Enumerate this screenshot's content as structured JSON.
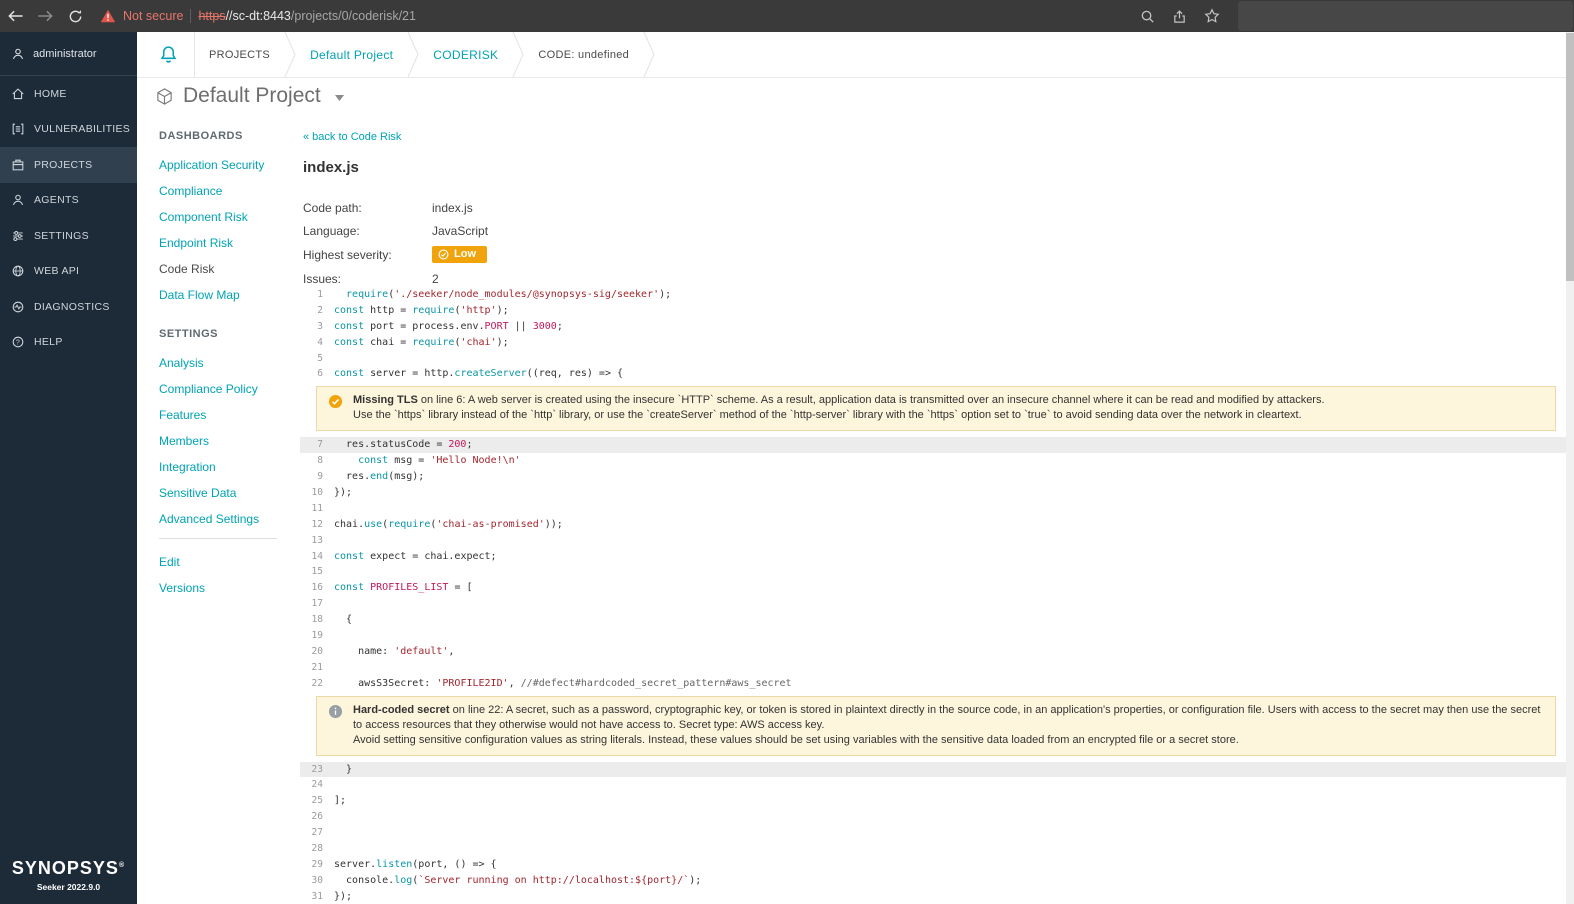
{
  "browser": {
    "security_label": "Not secure",
    "url_scheme": "https",
    "url_host": "//sc-dt:8443",
    "url_path": "/projects/0/coderisk/21"
  },
  "colors": {
    "accent_teal": "#00a3b4",
    "severity_low": "#f0a30a",
    "issue_background": "#fdf5dc",
    "sidebar_background": "#1d2a38",
    "not_secure_red": "#e0544a"
  },
  "sidebar": {
    "user": "administrator",
    "items": [
      {
        "label": "HOME",
        "icon": "home-icon",
        "active": false
      },
      {
        "label": "VULNERABILITIES",
        "icon": "vulnerabilities-icon",
        "active": false
      },
      {
        "label": "PROJECTS",
        "icon": "projects-icon",
        "active": true
      },
      {
        "label": "AGENTS",
        "icon": "agents-icon",
        "active": false
      },
      {
        "label": "SETTINGS",
        "icon": "settings-icon",
        "active": false
      },
      {
        "label": "WEB API",
        "icon": "webapi-icon",
        "active": false
      },
      {
        "label": "DIAGNOSTICS",
        "icon": "diagnostics-icon",
        "active": false
      },
      {
        "label": "HELP",
        "icon": "help-icon",
        "active": false
      }
    ],
    "logo": "SYNOPSYS",
    "logo_reg": "®",
    "version": "Seeker 2022.9.0"
  },
  "breadcrumb": {
    "items": [
      {
        "label": "PROJECTS",
        "style": "plain"
      },
      {
        "label": "Default Project",
        "style": "link"
      },
      {
        "label": "CODERISK",
        "style": "link"
      },
      {
        "label": "CODE: undefined",
        "style": "plain"
      }
    ]
  },
  "page": {
    "title": "Default Project"
  },
  "subnav": {
    "sections": [
      {
        "heading": "DASHBOARDS",
        "items": [
          {
            "label": "Application Security",
            "active": false
          },
          {
            "label": "Compliance",
            "active": false
          },
          {
            "label": "Component Risk",
            "active": false
          },
          {
            "label": "Endpoint Risk",
            "active": false
          },
          {
            "label": "Code Risk",
            "active": true
          },
          {
            "label": "Data Flow Map",
            "active": false
          }
        ]
      },
      {
        "heading": "SETTINGS",
        "items": [
          {
            "label": "Analysis",
            "active": false
          },
          {
            "label": "Compliance Policy",
            "active": false
          },
          {
            "label": "Features",
            "active": false
          },
          {
            "label": "Members",
            "active": false
          },
          {
            "label": "Integration",
            "active": false
          },
          {
            "label": "Sensitive Data",
            "active": false
          },
          {
            "label": "Advanced Settings",
            "active": false
          }
        ]
      }
    ],
    "footer_items": [
      {
        "label": "Edit"
      },
      {
        "label": "Versions"
      }
    ]
  },
  "content": {
    "back_link": "« back to Code Risk",
    "file_title": "index.js",
    "details": [
      {
        "label": "Code path:",
        "value": "index.js",
        "type": "text"
      },
      {
        "label": "Language:",
        "value": "JavaScript",
        "type": "text"
      },
      {
        "label": "Highest severity:",
        "value": "Low",
        "type": "badge"
      },
      {
        "label": "Issues:",
        "value": "2",
        "type": "text"
      }
    ]
  },
  "code": {
    "highlight_lines": [
      7,
      23
    ],
    "lines": [
      {
        "n": 1,
        "t": [
          [
            "kw",
            "  require"
          ],
          [
            "p",
            "("
          ],
          [
            "str",
            "'./seeker/node_modules/@synopsys-sig/seeker'"
          ],
          [
            "p",
            ");"
          ]
        ]
      },
      {
        "n": 2,
        "t": [
          [
            "kw",
            "const"
          ],
          [
            "p",
            " http = "
          ],
          [
            "kw",
            "require"
          ],
          [
            "p",
            "("
          ],
          [
            "str",
            "'http'"
          ],
          [
            "p",
            ");"
          ]
        ]
      },
      {
        "n": 3,
        "t": [
          [
            "kw",
            "const"
          ],
          [
            "p",
            " port = process.env."
          ],
          [
            "cn",
            "PORT"
          ],
          [
            "p",
            " || "
          ],
          [
            "num",
            "3000"
          ],
          [
            "p",
            ";"
          ]
        ]
      },
      {
        "n": 4,
        "t": [
          [
            "kw",
            "const"
          ],
          [
            "p",
            " chai = "
          ],
          [
            "kw",
            "require"
          ],
          [
            "p",
            "("
          ],
          [
            "str",
            "'chai'"
          ],
          [
            "p",
            ");"
          ]
        ]
      },
      {
        "n": 5,
        "t": []
      },
      {
        "n": 6,
        "t": [
          [
            "kw",
            "const"
          ],
          [
            "p",
            " server = http."
          ],
          [
            "fn",
            "createServer"
          ],
          [
            "p",
            "((req, res) => {"
          ]
        ]
      },
      {
        "n": 7,
        "t": [
          [
            "p",
            "  res.statusCode = "
          ],
          [
            "num",
            "200"
          ],
          [
            "p",
            ";"
          ]
        ]
      },
      {
        "n": 8,
        "t": [
          [
            "p",
            "    "
          ],
          [
            "kw",
            "const"
          ],
          [
            "p",
            " msg = "
          ],
          [
            "str",
            "'Hello Node!\\n'"
          ]
        ]
      },
      {
        "n": 9,
        "t": [
          [
            "p",
            "  res."
          ],
          [
            "fn",
            "end"
          ],
          [
            "p",
            "(msg);"
          ]
        ]
      },
      {
        "n": 10,
        "t": [
          [
            "p",
            "});"
          ]
        ]
      },
      {
        "n": 11,
        "t": []
      },
      {
        "n": 12,
        "t": [
          [
            "p",
            "chai."
          ],
          [
            "fn",
            "use"
          ],
          [
            "p",
            "("
          ],
          [
            "kw",
            "require"
          ],
          [
            "p",
            "("
          ],
          [
            "str",
            "'chai-as-promised'"
          ],
          [
            "p",
            "));"
          ]
        ]
      },
      {
        "n": 13,
        "t": []
      },
      {
        "n": 14,
        "t": [
          [
            "kw",
            "const"
          ],
          [
            "p",
            " expect = chai.expect;"
          ]
        ]
      },
      {
        "n": 15,
        "t": []
      },
      {
        "n": 16,
        "t": [
          [
            "kw",
            "const"
          ],
          [
            "p",
            " "
          ],
          [
            "cn",
            "PROFILES_LIST"
          ],
          [
            "p",
            " = ["
          ]
        ]
      },
      {
        "n": 17,
        "t": []
      },
      {
        "n": 18,
        "t": [
          [
            "p",
            "  {"
          ]
        ]
      },
      {
        "n": 19,
        "t": []
      },
      {
        "n": 20,
        "t": [
          [
            "p",
            "    name: "
          ],
          [
            "str",
            "'default'"
          ],
          [
            "p",
            ","
          ]
        ]
      },
      {
        "n": 21,
        "t": []
      },
      {
        "n": 22,
        "t": [
          [
            "p",
            "    awsS3Secret: "
          ],
          [
            "str",
            "'PROFILE2ID'"
          ],
          [
            "p",
            ", "
          ],
          [
            "com",
            "//#defect#hardcoded_secret_pattern#aws_secret"
          ]
        ]
      },
      {
        "n": 23,
        "t": [
          [
            "p",
            "  }"
          ]
        ]
      },
      {
        "n": 24,
        "t": []
      },
      {
        "n": 25,
        "t": [
          [
            "p",
            "];"
          ]
        ]
      },
      {
        "n": 26,
        "t": []
      },
      {
        "n": 27,
        "t": []
      },
      {
        "n": 28,
        "t": []
      },
      {
        "n": 29,
        "t": [
          [
            "p",
            "server."
          ],
          [
            "fn",
            "listen"
          ],
          [
            "p",
            "(port, () => {"
          ]
        ]
      },
      {
        "n": 30,
        "t": [
          [
            "p",
            "  console."
          ],
          [
            "fn",
            "log"
          ],
          [
            "p",
            "("
          ],
          [
            "str",
            "`Server running on http://localhost:${port}/`"
          ],
          [
            "p",
            ");"
          ]
        ]
      },
      {
        "n": 31,
        "t": [
          [
            "p",
            "});"
          ]
        ]
      }
    ],
    "issues": [
      {
        "after_line": 6,
        "severity": "low",
        "icon": "check-circle-icon",
        "title": "Missing TLS",
        "text": " on line 6: A web server is created using the insecure `HTTP` scheme. As a result, application data is transmitted over an insecure channel where it can be read and modified by attackers.",
        "text2": "Use the `https` library instead of the `http` library, or use the `createServer` method of the `http-server` library with the `https` option set to `true` to avoid sending data over the network in cleartext."
      },
      {
        "after_line": 22,
        "severity": "info",
        "icon": "info-circle-icon",
        "title": "Hard-coded secret",
        "text": " on line 22: A secret, such as a password, cryptographic key, or token is stored in plaintext directly in the source code, in an application's properties, or configuration file. Users with access to the secret may then use the secret to access resources that they otherwise would not have access to. Secret type: AWS access key.",
        "text2": "Avoid setting sensitive configuration values as string literals. Instead, these values should be set using variables with the sensitive data loaded from an encrypted file or a secret store."
      }
    ]
  }
}
